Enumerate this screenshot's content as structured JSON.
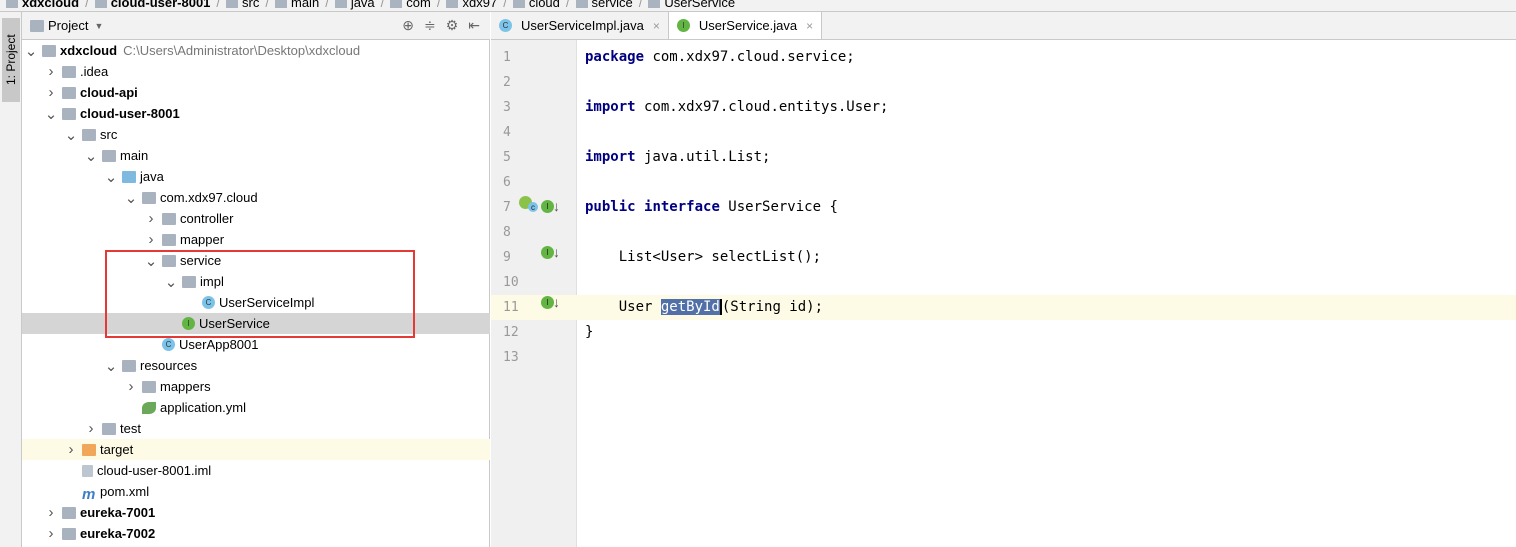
{
  "breadcrumbs": [
    "xdxcloud",
    "cloud-user-8001",
    "src",
    "main",
    "java",
    "com",
    "xdx97",
    "cloud",
    "service",
    "UserService"
  ],
  "side_tab": "1: Project",
  "panel": {
    "title": "Project",
    "icons": [
      "target-icon",
      "collapse-icon",
      "gear-icon",
      "hide-icon"
    ]
  },
  "tree": [
    {
      "label": "xdxcloud",
      "level": 0,
      "arrow": "down",
      "icon": "module",
      "bold": true,
      "path": "C:\\Users\\Administrator\\Desktop\\xdxcloud"
    },
    {
      "label": ".idea",
      "level": 1,
      "arrow": "right",
      "icon": "folder"
    },
    {
      "label": "cloud-api",
      "level": 1,
      "arrow": "right",
      "icon": "module",
      "bold": true
    },
    {
      "label": "cloud-user-8001",
      "level": 1,
      "arrow": "down",
      "icon": "module",
      "bold": true
    },
    {
      "label": "src",
      "level": 2,
      "arrow": "down",
      "icon": "folder"
    },
    {
      "label": "main",
      "level": 3,
      "arrow": "down",
      "icon": "folder"
    },
    {
      "label": "java",
      "level": 4,
      "arrow": "down",
      "icon": "source"
    },
    {
      "label": "com.xdx97.cloud",
      "level": 5,
      "arrow": "down",
      "icon": "folder"
    },
    {
      "label": "controller",
      "level": 6,
      "arrow": "right",
      "icon": "folder"
    },
    {
      "label": "mapper",
      "level": 6,
      "arrow": "right",
      "icon": "folder"
    },
    {
      "label": "service",
      "level": 6,
      "arrow": "down",
      "icon": "folder"
    },
    {
      "label": "impl",
      "level": 7,
      "arrow": "down",
      "icon": "folder"
    },
    {
      "label": "UserServiceImpl",
      "level": 8,
      "arrow": "",
      "icon": "class"
    },
    {
      "label": "UserService",
      "level": 7,
      "arrow": "",
      "icon": "interface",
      "selected": true
    },
    {
      "label": "UserApp8001",
      "level": 6,
      "arrow": "",
      "icon": "class"
    },
    {
      "label": "resources",
      "level": 4,
      "arrow": "down",
      "icon": "folder"
    },
    {
      "label": "mappers",
      "level": 5,
      "arrow": "right",
      "icon": "folder"
    },
    {
      "label": "application.yml",
      "level": 5,
      "arrow": "",
      "icon": "yml"
    },
    {
      "label": "test",
      "level": 3,
      "arrow": "right",
      "icon": "folder"
    },
    {
      "label": "target",
      "level": 2,
      "arrow": "right",
      "icon": "excluded",
      "highlight": true
    },
    {
      "label": "cloud-user-8001.iml",
      "level": 2,
      "arrow": "",
      "icon": "file"
    },
    {
      "label": "pom.xml",
      "level": 2,
      "arrow": "",
      "icon": "maven"
    },
    {
      "label": "eureka-7001",
      "level": 1,
      "arrow": "right",
      "icon": "module",
      "bold": true
    },
    {
      "label": "eureka-7002",
      "level": 1,
      "arrow": "right",
      "icon": "module",
      "bold": true
    }
  ],
  "editor_tabs": [
    {
      "label": "UserServiceImpl.java",
      "icon": "C",
      "active": false
    },
    {
      "label": "UserService.java",
      "icon": "I",
      "active": true
    }
  ],
  "code_lines": [
    [
      {
        "t": "package",
        "k": 1
      },
      {
        "t": " com.xdx97.cloud.service;"
      }
    ],
    [],
    [
      {
        "t": "import",
        "k": 1
      },
      {
        "t": " com.xdx97.cloud.entitys.User;"
      }
    ],
    [],
    [
      {
        "t": "import",
        "k": 1
      },
      {
        "t": " java.util.List;"
      }
    ],
    [],
    [
      {
        "t": "public",
        "k": 1
      },
      {
        "t": " "
      },
      {
        "t": "interface",
        "k": 1
      },
      {
        "t": " UserService {"
      }
    ],
    [],
    [
      {
        "t": "    List<User> selectList();"
      }
    ],
    [],
    [
      {
        "t": "    User "
      },
      {
        "t": "getById",
        "s": 1
      },
      {
        "t": "(String id);"
      }
    ],
    [
      {
        "t": "}"
      }
    ],
    []
  ],
  "current_line": 11,
  "colors": {
    "keyword": "#000080",
    "selection": "#5170a8",
    "current_line": "#fdfbe6",
    "highlight_box": "#e53935"
  }
}
